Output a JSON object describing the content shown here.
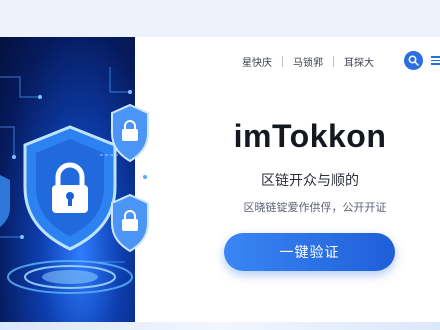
{
  "nav": {
    "items": [
      "星快庆",
      "马锁郛",
      "耳探大"
    ]
  },
  "icons": {
    "search": "search-icon",
    "menu": "menu-icon",
    "hero": "shield-lock-icon"
  },
  "hero": {
    "brand": "imTokkon",
    "tagline": "区链开众与顺的",
    "subline": "区晓链锭爱作供俘，公开开证",
    "cta_label": "一键验证"
  },
  "colors": {
    "accent": "#2a6fe0",
    "hero_dark": "#061a5c",
    "text": "#14181f"
  }
}
